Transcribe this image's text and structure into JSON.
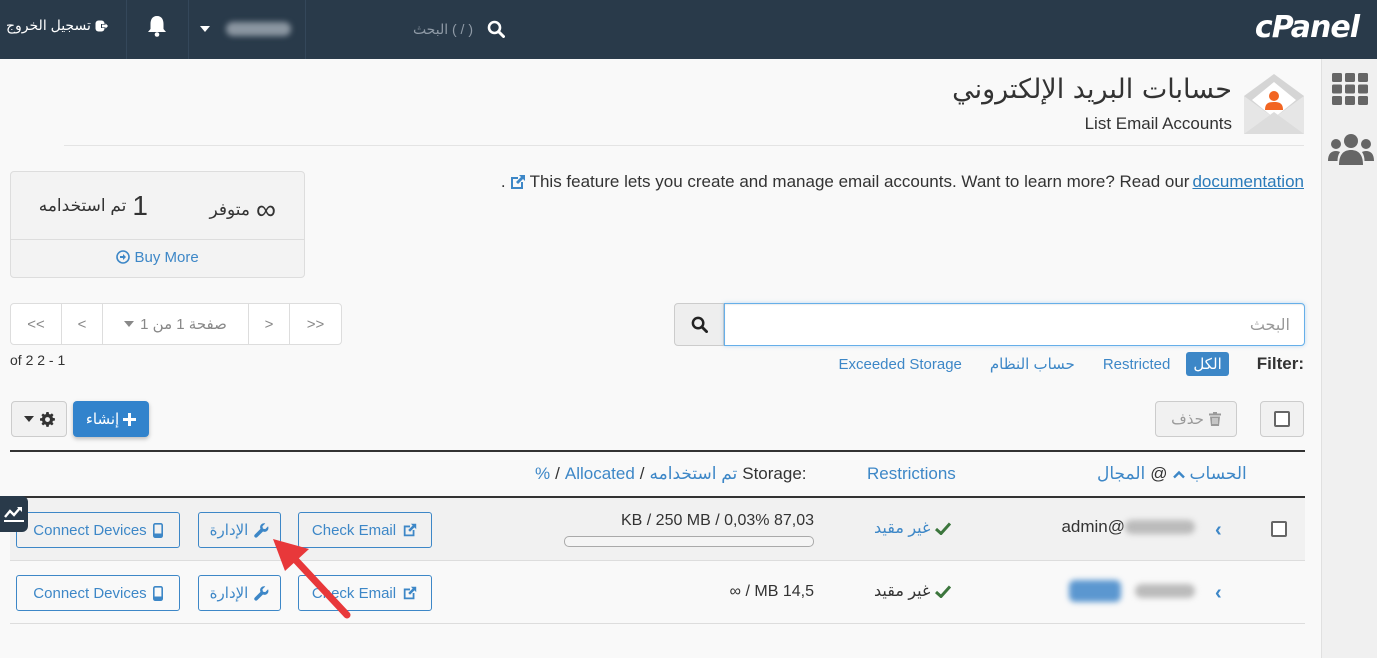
{
  "topbar": {
    "brand": "cPanel",
    "search_placeholder": "البحث ( / )",
    "logout_label": "تسجيل الخروج"
  },
  "header": {
    "title_ar": "حسابات البريد الإلكتروني",
    "title_en": "List Email Accounts",
    "description": "This feature lets you create and manage email accounts. Want to learn more? Read our",
    "doc_link": "documentation",
    "period": "."
  },
  "stats": {
    "available_value": "∞",
    "available_label": "متوفر",
    "used_value": "1",
    "used_label": "تم استخدامه",
    "buy_more": "Buy More"
  },
  "pagination": {
    "first": "<<",
    "prev": "<",
    "page_label": "صفحة 1 من 1",
    "next": ">",
    "last": ">>",
    "range": "of 2 2 - 1"
  },
  "search": {
    "placeholder": "البحث"
  },
  "filter": {
    "label": "Filter:",
    "options": [
      "الكل",
      "Restricted",
      "حساب النظام",
      "Exceeded Storage"
    ],
    "active": "الكل"
  },
  "actions": {
    "create": "إنشاء",
    "delete": "حذف"
  },
  "table": {
    "headers": {
      "account": "الحساب",
      "at": "@",
      "domain": "المجال",
      "restrictions": "Restrictions",
      "storage_label": "Storage:",
      "storage_used": "تم استخدامه",
      "storage_allocated": "Allocated",
      "storage_percent": "%"
    },
    "rows": [
      {
        "account": "admin@",
        "restriction": "غير مقيد",
        "storage": "KB / 250 MB / 0,03% 87,03",
        "usage_percent": 0.03,
        "check_email": "Check Email",
        "manage": "الإدارة",
        "connect": "Connect Devices"
      },
      {
        "account": "",
        "restriction": "غير مقيد",
        "storage": "∞ / MB 14,5",
        "check_email": "Check Email",
        "manage": "الإدارة",
        "connect": "Connect Devices"
      }
    ]
  }
}
